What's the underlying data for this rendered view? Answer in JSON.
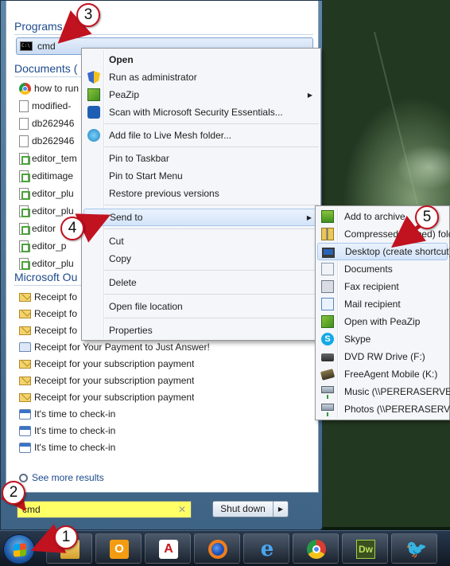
{
  "start_menu": {
    "programs_header": "Programs (1)",
    "program_item": "cmd",
    "documents_header": "Documents (",
    "documents": [
      {
        "label": "how to run",
        "icon": "chrome-icon"
      },
      {
        "label": "modified-",
        "icon": "document-icon"
      },
      {
        "label": "db262946",
        "icon": "document-icon"
      },
      {
        "label": "db262946",
        "icon": "document-icon"
      },
      {
        "label": "editor_tem",
        "icon": "green-document-icon"
      },
      {
        "label": "editimage",
        "icon": "green-document-icon"
      },
      {
        "label": "editor_plu",
        "icon": "green-document-icon"
      },
      {
        "label": "editor_plu",
        "icon": "green-document-icon"
      },
      {
        "label": "editor",
        "icon": "green-document-icon"
      },
      {
        "label": "editor_p",
        "icon": "green-document-icon"
      },
      {
        "label": "editor_plu",
        "icon": "green-document-icon"
      }
    ],
    "outlook_header": "Microsoft Ou",
    "outlook_items": [
      {
        "label": "Receipt fo",
        "icon": "mail-icon"
      },
      {
        "label": "Receipt fo",
        "icon": "mail-icon"
      },
      {
        "label": "Receipt fo",
        "icon": "mail-icon"
      },
      {
        "label": "Receipt for Your Payment to Just Answer!",
        "icon": "open-mail-icon"
      },
      {
        "label": "Receipt for your subscription payment",
        "icon": "mail-icon"
      },
      {
        "label": "Receipt for your subscription payment",
        "icon": "mail-icon"
      },
      {
        "label": "Receipt for your subscription payment",
        "icon": "mail-icon"
      },
      {
        "label": "It's time to check-in",
        "icon": "calendar-icon"
      },
      {
        "label": "It's time to check-in",
        "icon": "calendar-icon"
      },
      {
        "label": "It's time to check-in",
        "icon": "calendar-icon"
      }
    ],
    "see_more": "See more results",
    "search_value": "cmd",
    "clear_glyph": "✕",
    "shutdown_label": "Shut down",
    "shutdown_arrow": "▶"
  },
  "context_menu": {
    "items": [
      {
        "label": "Open",
        "icon": "",
        "bold": true
      },
      {
        "label": "Run as administrator",
        "icon": "shield-icon"
      },
      {
        "label": "PeaZip",
        "icon": "peazip-icon",
        "submenu": true
      },
      {
        "label": "Scan with Microsoft Security Essentials...",
        "icon": "security-essentials-icon"
      },
      {
        "label": "Add file to Live Mesh folder...",
        "icon": "live-mesh-icon"
      },
      {
        "label": "Pin to Taskbar",
        "icon": ""
      },
      {
        "label": "Pin to Start Menu",
        "icon": ""
      },
      {
        "label": "Restore previous versions",
        "icon": ""
      },
      {
        "label": "Send to",
        "icon": "",
        "submenu": true,
        "highlighted": true
      },
      {
        "label": "Cut",
        "icon": ""
      },
      {
        "label": "Copy",
        "icon": ""
      },
      {
        "label": "Delete",
        "icon": ""
      },
      {
        "label": "Open file location",
        "icon": ""
      },
      {
        "label": "Properties",
        "icon": ""
      }
    ],
    "submenu_arrow": "▶"
  },
  "send_to_menu": {
    "items": [
      {
        "label": "Add to archive",
        "icon": "peazip-archive-icon"
      },
      {
        "label": "Compressed (zipped) folder",
        "icon": "zip-folder-icon"
      },
      {
        "label": "Desktop (create shortcut)",
        "icon": "desktop-icon",
        "highlighted": true
      },
      {
        "label": "Documents",
        "icon": "documents-icon"
      },
      {
        "label": "Fax recipient",
        "icon": "fax-icon"
      },
      {
        "label": "Mail recipient",
        "icon": "mail-recipient-icon"
      },
      {
        "label": "Open with PeaZip",
        "icon": "peazip-icon"
      },
      {
        "label": "Skype",
        "icon": "skype-icon"
      },
      {
        "label": "DVD RW Drive (F:)",
        "icon": "dvd-drive-icon"
      },
      {
        "label": "FreeAgent Mobile (K:)",
        "icon": "external-drive-icon"
      },
      {
        "label": "Music (\\\\PERERASERVER)",
        "icon": "network-drive-icon"
      },
      {
        "label": "Photos (\\\\PERERASERVER)",
        "icon": "network-drive-icon"
      }
    ],
    "skype_glyph": "S"
  },
  "taskbar": {
    "apps": [
      {
        "name": "windows-explorer",
        "glyph": ""
      },
      {
        "name": "outlook",
        "glyph": "O"
      },
      {
        "name": "acrobat",
        "glyph": "A"
      },
      {
        "name": "firefox",
        "glyph": ""
      },
      {
        "name": "internet-explorer",
        "glyph": "e"
      },
      {
        "name": "chrome",
        "glyph": ""
      },
      {
        "name": "dreamweaver",
        "glyph": "Dw"
      },
      {
        "name": "twitter",
        "glyph": "🐦"
      }
    ]
  },
  "annotations": {
    "badges": [
      "1",
      "2",
      "3",
      "4",
      "5"
    ],
    "color": "#c1121f"
  },
  "colors": {
    "accent": "#1d4a8c",
    "search_highlight": "#ffff66",
    "annotation_red": "#c1121f"
  }
}
